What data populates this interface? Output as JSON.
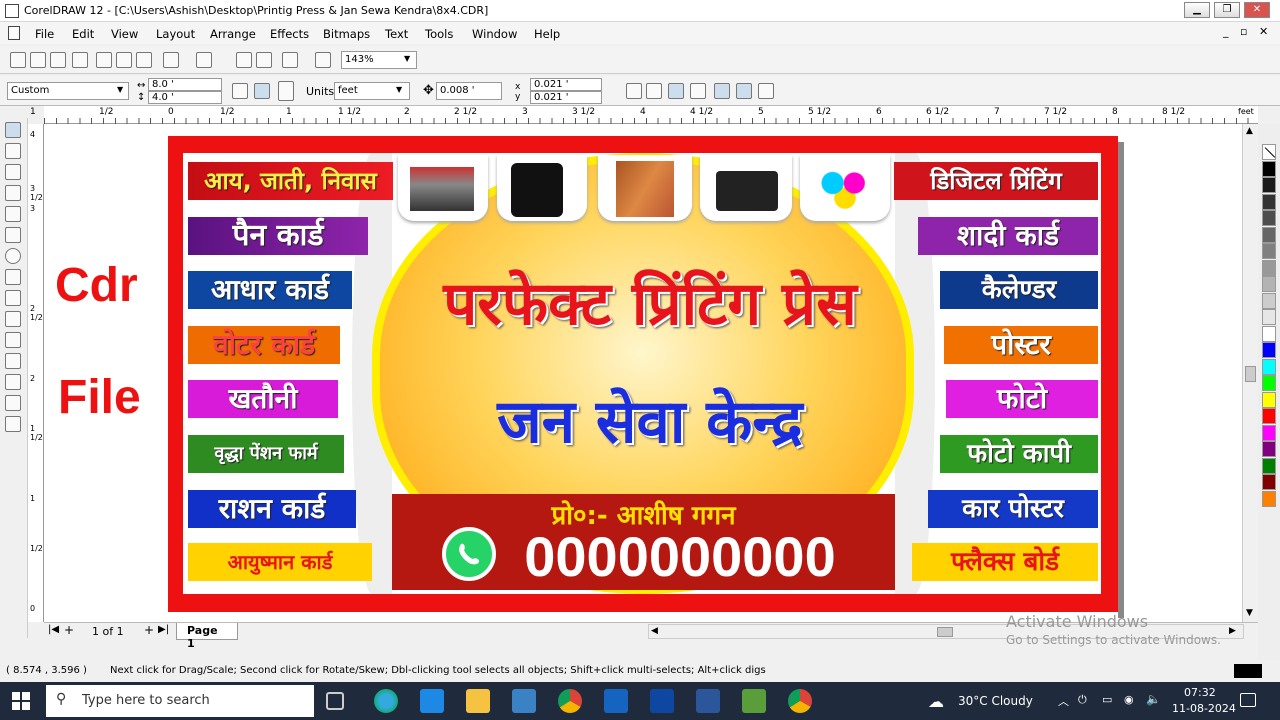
{
  "window": {
    "title": "CorelDRAW 12 - [C:\\Users\\Ashish\\Desktop\\Printig Press & Jan Sewa Kendra\\8x4.CDR]"
  },
  "menu": [
    "File",
    "Edit",
    "View",
    "Layout",
    "Arrange",
    "Effects",
    "Bitmaps",
    "Text",
    "Tools",
    "Window",
    "Help"
  ],
  "toolbar": {
    "zoom": "143%",
    "preset": "Custom",
    "width": "8.0 '",
    "height": "4.0 '",
    "units_label": "Units:",
    "units": "feet",
    "nudge": "0.008 '",
    "dup_x": "0.021 '",
    "dup_y": "0.021 '"
  },
  "ruler": {
    "unit": "feet",
    "ticks": [
      "1",
      "1/2",
      "0",
      "1/2",
      "1",
      "1 1/2",
      "2",
      "2 1/2",
      "3",
      "3 1/2",
      "4",
      "4 1/2",
      "5",
      "5 1/2",
      "6",
      "6 1/2",
      "7",
      "7 1/2",
      "8",
      "8 1/2"
    ],
    "vticks": [
      "4",
      "3 1/2",
      "3",
      "2 1/2",
      "2",
      "1 1/2",
      "1",
      "1/2",
      "0"
    ]
  },
  "overlay": {
    "line1": "Cdr",
    "line2": "File"
  },
  "banner": {
    "title": "परफेक्ट प्रिंटिंग प्रेस",
    "subtitle": "जन सेवा केन्द्र",
    "proprietor": "प्रो०:- आशीष गगन",
    "phone": "0000000000",
    "left_items": [
      "आय, जाती, निवास",
      "पैन कार्ड",
      "आधार कार्ड",
      "वोटर कार्ड",
      "खतौनी",
      "वृद्धा पेंशन फार्म",
      "राशन कार्ड",
      "आयुष्मान कार्ड"
    ],
    "right_items": [
      "डिजिटल प्रिंटिंग",
      "शादी कार्ड",
      "कैलेण्डर",
      "पोस्टर",
      "फोटो",
      "फोटो कापी",
      "कार पोस्टर",
      "फ्लैक्स बोर्ड"
    ],
    "left_colors": [
      "#e8141c",
      "#7b1fa2",
      "#0d47a1",
      "#ef6c00",
      "#d81bd8",
      "#2e8b22",
      "#1030c8",
      "#ffd200"
    ],
    "right_colors": [
      "#d0141c",
      "#8e24aa",
      "#0d3a8c",
      "#f07000",
      "#e020e0",
      "#2e9a22",
      "#1438c8",
      "#ffd200"
    ],
    "photos": [
      "printer-machine",
      "photo-mug",
      "wedding-cards",
      "inkjet-printer",
      "cmyk-ink-splash"
    ]
  },
  "nav": {
    "page_count": "1 of 1",
    "page_tab": "Page 1"
  },
  "watermark": {
    "line1": "Activate Windows",
    "line2": "Go to Settings to activate Windows."
  },
  "status": {
    "coords": "( 8.574 , 3.596 )",
    "hint": "Next click for Drag/Scale; Second click for Rotate/Skew; Dbl-clicking tool selects all objects; Shift+click multi-selects; Alt+click digs"
  },
  "taskbar": {
    "search": "Type here to search",
    "weather": "30°C  Cloudy",
    "time": "07:32",
    "date": "11-08-2024"
  },
  "palette": [
    "#ffffff",
    "#000000",
    "#1a1a1a",
    "#333333",
    "#4d4d4d",
    "#666666",
    "#808080",
    "#999999",
    "#b3b3b3",
    "#cccccc",
    "#e6e6e6",
    "#ffffff",
    "#0000ff",
    "#00ffff",
    "#00ff00",
    "#ffff00",
    "#ff0000",
    "#ff00ff",
    "#800080",
    "#008000",
    "#800000",
    "#ff8000"
  ]
}
